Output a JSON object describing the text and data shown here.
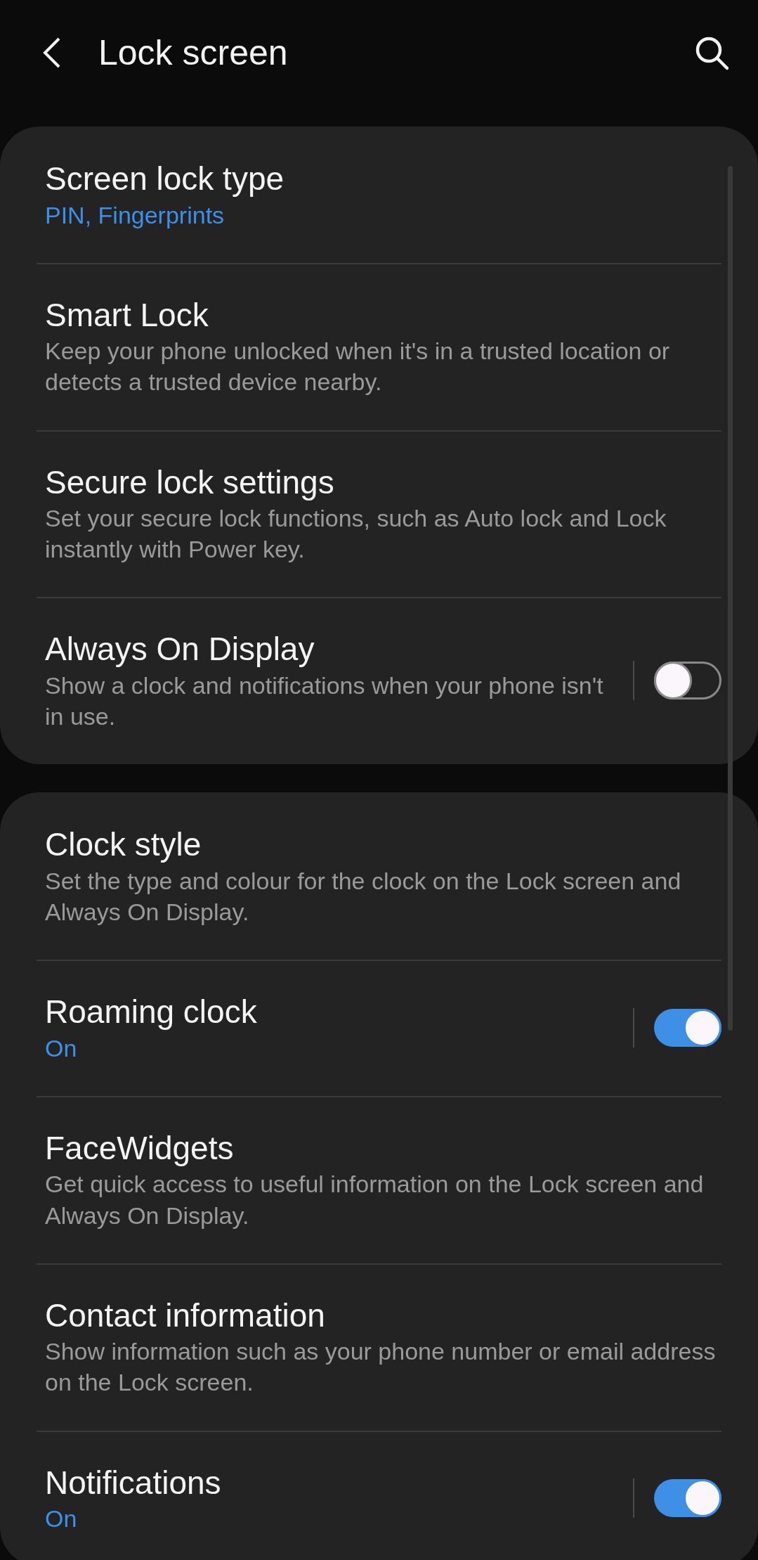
{
  "header": {
    "title": "Lock screen"
  },
  "groups": [
    {
      "items": [
        {
          "kind": "link",
          "title": "Screen lock type",
          "value": "PIN, Fingerprints"
        },
        {
          "kind": "link",
          "title": "Smart Lock",
          "description": "Keep your phone unlocked when it's in a trusted location or detects a trusted device nearby."
        },
        {
          "kind": "link",
          "title": "Secure lock settings",
          "description": "Set your secure lock functions, such as Auto lock and Lock instantly with Power key."
        },
        {
          "kind": "toggle",
          "title": "Always On Display",
          "description": "Show a clock and notifications when your phone isn't in use.",
          "on": false
        }
      ]
    },
    {
      "items": [
        {
          "kind": "link",
          "title": "Clock style",
          "description": "Set the type and colour for the clock on the Lock screen and Always On Display."
        },
        {
          "kind": "toggle",
          "title": "Roaming clock",
          "value": "On",
          "on": true
        },
        {
          "kind": "link",
          "title": "FaceWidgets",
          "description": "Get quick access to useful information on the Lock screen and Always On Display."
        },
        {
          "kind": "link",
          "title": "Contact information",
          "description": "Show information such as your phone number or email address on the Lock screen."
        },
        {
          "kind": "toggle",
          "title": "Notifications",
          "value": "On",
          "on": true
        }
      ]
    }
  ]
}
